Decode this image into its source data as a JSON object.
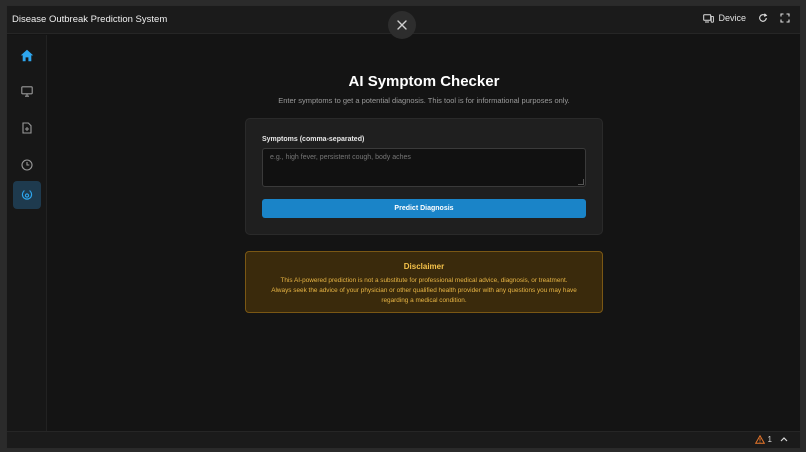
{
  "window": {
    "title": "Disease Outbreak Prediction System",
    "device_label": "Device"
  },
  "sidebar": {
    "items": [
      {
        "icon": "home-icon",
        "active": false
      },
      {
        "icon": "monitor-icon",
        "active": false
      },
      {
        "icon": "document-icon",
        "active": false
      },
      {
        "icon": "clock-icon",
        "active": false
      },
      {
        "icon": "stethoscope-icon",
        "active": true
      }
    ]
  },
  "main": {
    "title": "AI Symptom Checker",
    "subtitle": "Enter symptoms to get a potential diagnosis. This tool is for informational purposes only.",
    "form": {
      "label": "Symptoms (comma-separated)",
      "input_value": "",
      "placeholder": "e.g., high fever, persistent cough, body aches",
      "button_label": "Predict Diagnosis"
    },
    "disclaimer": {
      "title": "Disclaimer",
      "line1": "This AI-powered prediction is not a substitute for professional medical advice, diagnosis, or treatment.",
      "line2": "Always seek the advice of your physician or other qualified health provider with any questions you may have",
      "line3": "regarding a medical condition."
    }
  },
  "statusbar": {
    "warning_count": "1"
  },
  "colors": {
    "accent": "#1a84c8",
    "active_icon": "#2ea6ee",
    "warning": "#f5c24a",
    "warning_bg": "#3a2a0c"
  }
}
